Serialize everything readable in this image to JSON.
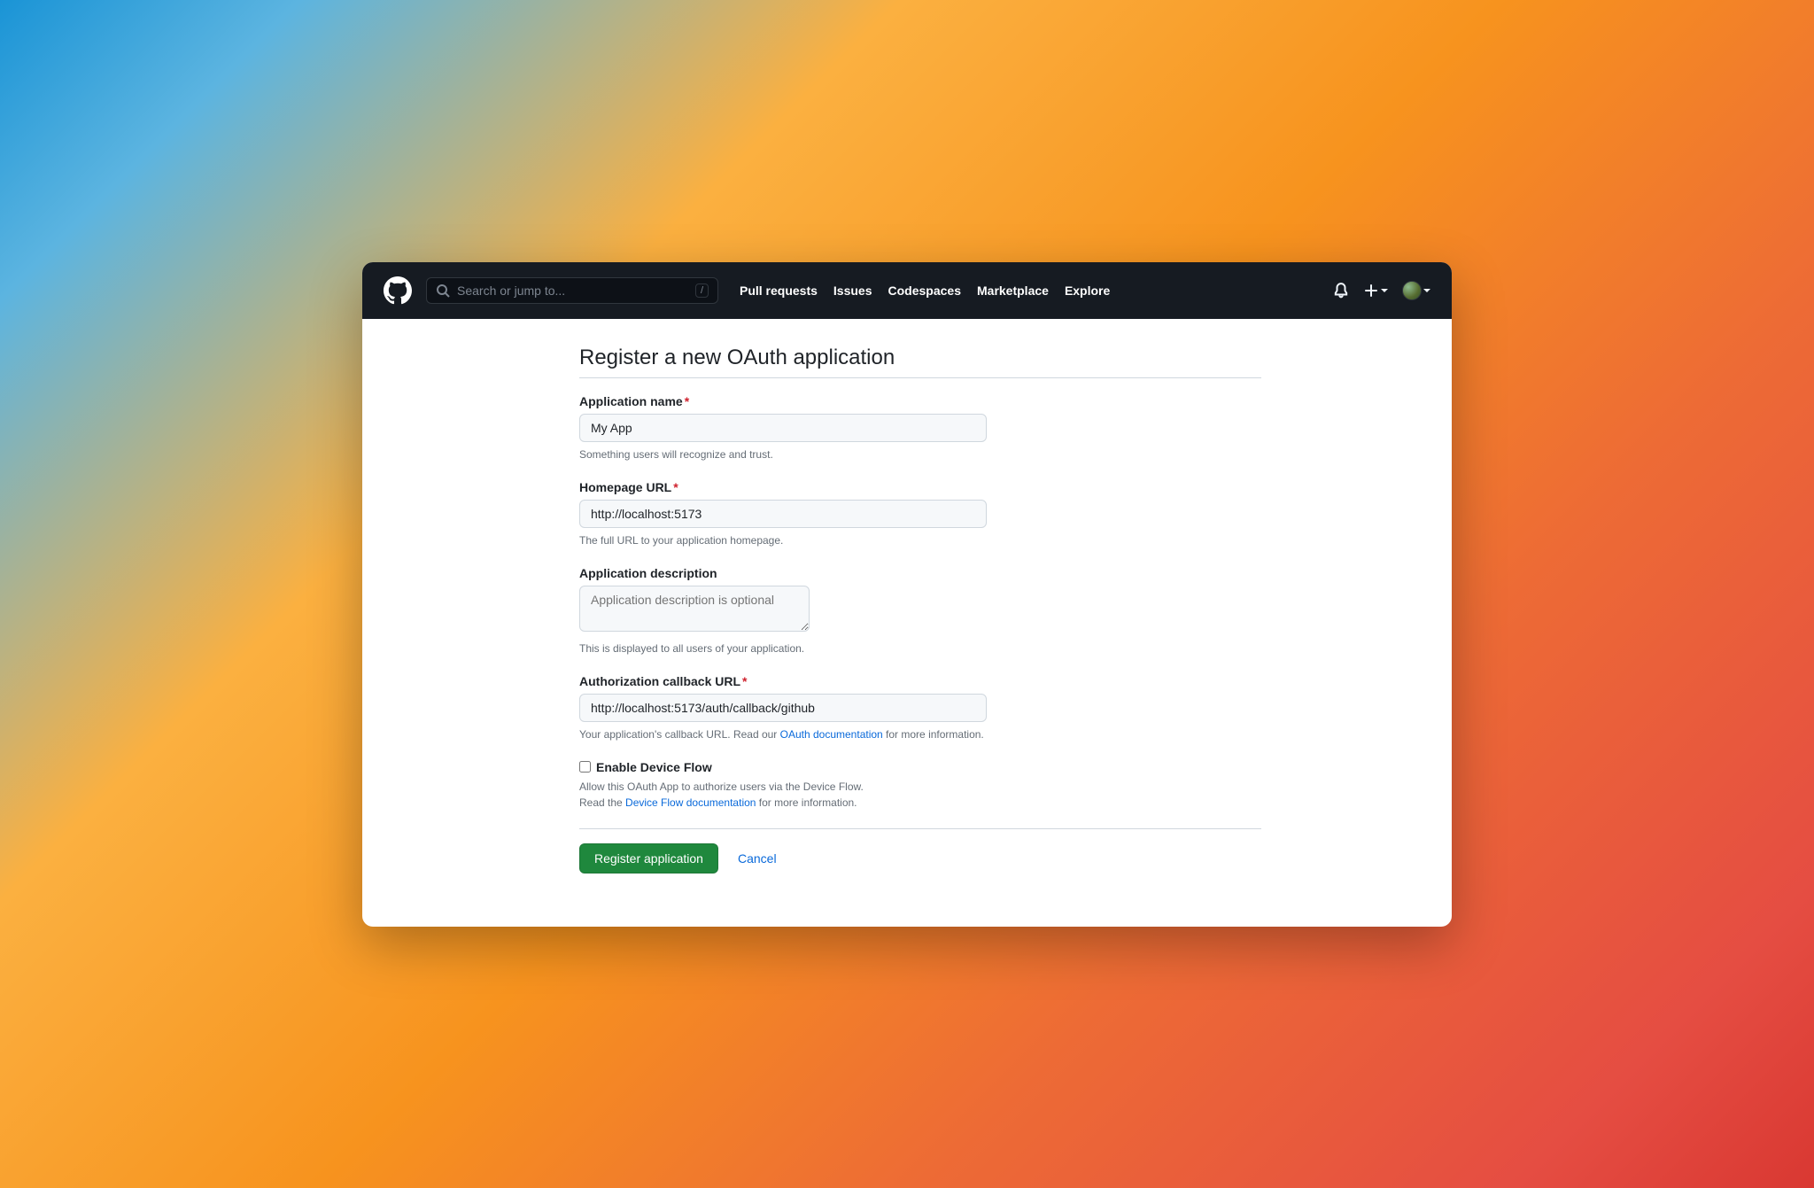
{
  "search": {
    "placeholder": "Search or jump to...",
    "kbd": "/"
  },
  "nav": {
    "pull_requests": "Pull requests",
    "issues": "Issues",
    "codespaces": "Codespaces",
    "marketplace": "Marketplace",
    "explore": "Explore"
  },
  "page": {
    "title": "Register a new OAuth application"
  },
  "form": {
    "app_name": {
      "label": "Application name",
      "value": "My App",
      "help": "Something users will recognize and trust."
    },
    "homepage": {
      "label": "Homepage URL",
      "value": "http://localhost:5173",
      "help": "The full URL to your application homepage."
    },
    "description": {
      "label": "Application description",
      "placeholder": "Application description is optional",
      "help": "This is displayed to all users of your application."
    },
    "callback": {
      "label": "Authorization callback URL",
      "value": "http://localhost:5173/auth/callback/github",
      "help_before": "Your application's callback URL. Read our ",
      "help_link": "OAuth documentation",
      "help_after": " for more information."
    },
    "device_flow": {
      "label": "Enable Device Flow",
      "help1": "Allow this OAuth App to authorize users via the Device Flow.",
      "help2_before": "Read the ",
      "help2_link": "Device Flow documentation",
      "help2_after": " for more information."
    }
  },
  "actions": {
    "register": "Register application",
    "cancel": "Cancel"
  }
}
